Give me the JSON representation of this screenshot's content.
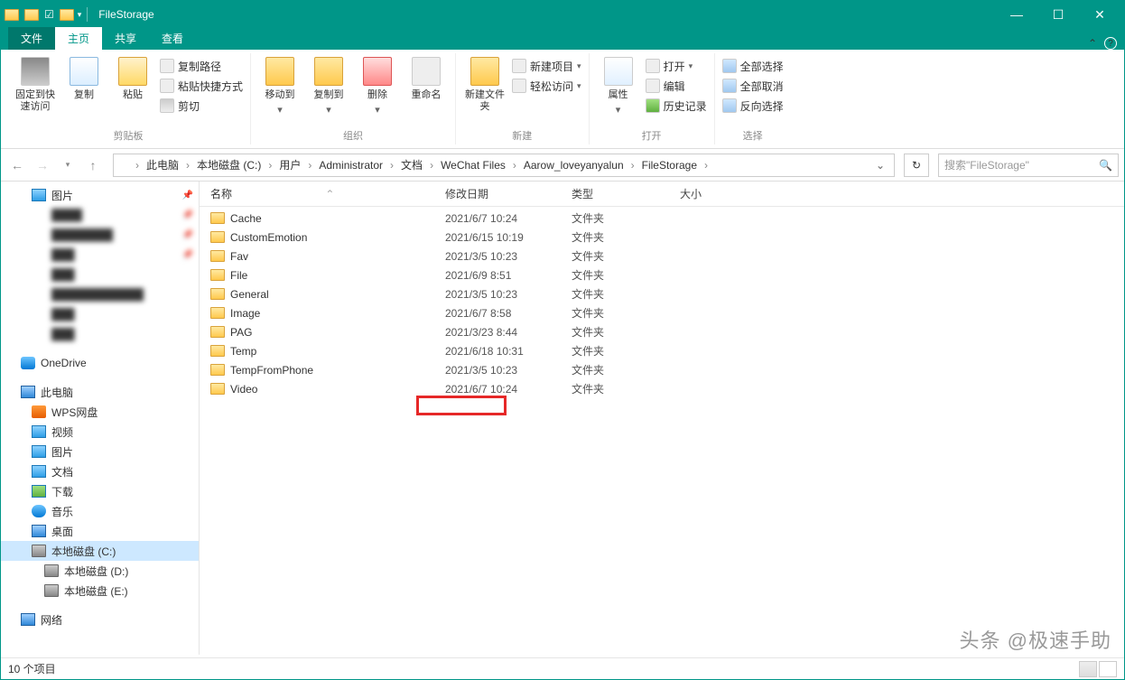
{
  "titlebar": {
    "title": "FileStorage",
    "minimize": "—",
    "maximize": "☐",
    "close": "✕"
  },
  "tabs": {
    "file": "文件",
    "home": "主页",
    "share": "共享",
    "view": "查看"
  },
  "ribbon": {
    "pin": "固定到快速访问",
    "copy": "复制",
    "paste": "粘贴",
    "copy_path": "复制路径",
    "paste_shortcut": "粘贴快捷方式",
    "cut": "剪切",
    "clipboard_group": "剪贴板",
    "move_to": "移动到",
    "copy_to": "复制到",
    "delete": "删除",
    "rename": "重命名",
    "organize_group": "组织",
    "new_folder": "新建文件夹",
    "new_item": "新建项目",
    "easy_access": "轻松访问",
    "new_group": "新建",
    "properties": "属性",
    "open": "打开",
    "edit": "编辑",
    "history": "历史记录",
    "open_group": "打开",
    "select_all": "全部选择",
    "select_none": "全部取消",
    "invert_sel": "反向选择",
    "select_group": "选择"
  },
  "breadcrumb": {
    "items": [
      "此电脑",
      "本地磁盘 (C:)",
      "用户",
      "Administrator",
      "文档",
      "WeChat Files",
      "Aarow_loveyanyalun",
      "FileStorage"
    ]
  },
  "search": {
    "placeholder": "搜索\"FileStorage\""
  },
  "sidebar": {
    "pictures": "图片",
    "onedrive": "OneDrive",
    "this_pc": "此电脑",
    "wps": "WPS网盘",
    "video": "视频",
    "pics2": "图片",
    "docs": "文档",
    "downloads": "下载",
    "music": "音乐",
    "desktop": "桌面",
    "drive_c": "本地磁盘 (C:)",
    "drive_d": "本地磁盘 (D:)",
    "drive_e": "本地磁盘 (E:)",
    "network": "网络"
  },
  "columns": {
    "name": "名称",
    "date": "修改日期",
    "type": "类型",
    "size": "大小"
  },
  "files": [
    {
      "name": "Cache",
      "date": "2021/6/7 10:24",
      "type": "文件夹"
    },
    {
      "name": "CustomEmotion",
      "date": "2021/6/15 10:19",
      "type": "文件夹"
    },
    {
      "name": "Fav",
      "date": "2021/3/5 10:23",
      "type": "文件夹"
    },
    {
      "name": "File",
      "date": "2021/6/9 8:51",
      "type": "文件夹"
    },
    {
      "name": "General",
      "date": "2021/3/5 10:23",
      "type": "文件夹"
    },
    {
      "name": "Image",
      "date": "2021/6/7 8:58",
      "type": "文件夹"
    },
    {
      "name": "PAG",
      "date": "2021/3/23 8:44",
      "type": "文件夹"
    },
    {
      "name": "Temp",
      "date": "2021/6/18 10:31",
      "type": "文件夹"
    },
    {
      "name": "TempFromPhone",
      "date": "2021/3/5 10:23",
      "type": "文件夹"
    },
    {
      "name": "Video",
      "date": "2021/6/7 10:24",
      "type": "文件夹"
    }
  ],
  "status": {
    "count": "10 个项目"
  },
  "watermark": "头条 @极速手助"
}
